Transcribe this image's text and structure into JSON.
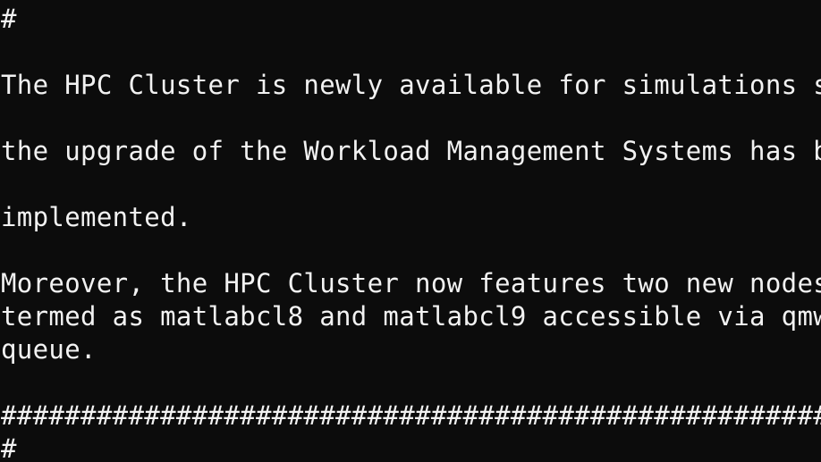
{
  "terminal": {
    "background": "#0c0c0c",
    "foreground": "#f2f2f2",
    "lines": [
      "#",
      "",
      "The HPC Cluster is newly available for simulations s",
      "",
      "the upgrade of the Workload Management Systems has b",
      "",
      "implemented.",
      "",
      "Moreover, the HPC Cluster now features two new nodes",
      "termed as matlabcl8 and matlabcl9 accessible via qmw",
      "queue.",
      "",
      "####################################################",
      "#"
    ]
  }
}
